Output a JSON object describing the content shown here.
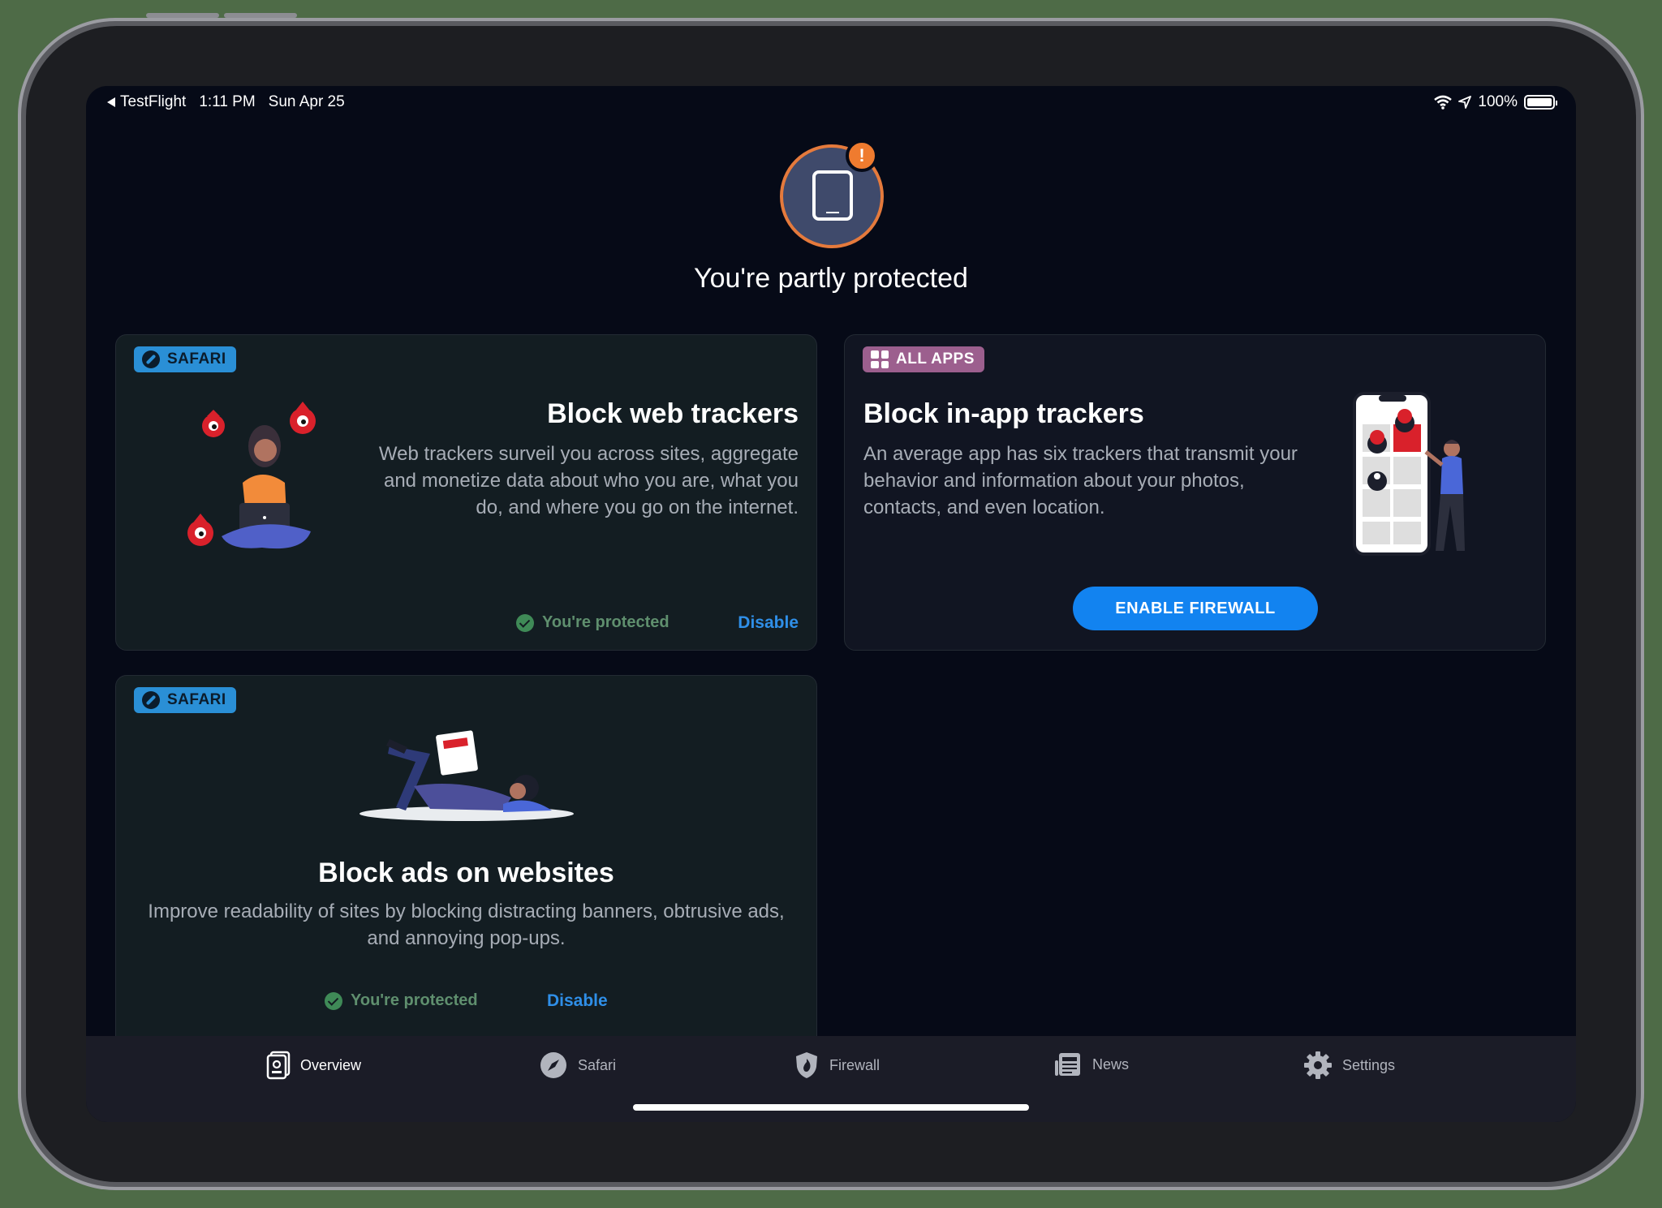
{
  "status_bar": {
    "back_app": "TestFlight",
    "time": "1:11 PM",
    "date": "Sun Apr 25",
    "battery": "100%"
  },
  "hero": {
    "badge": "!",
    "title": "You're partly protected"
  },
  "cards": {
    "web_trackers": {
      "chip": "SAFARI",
      "title": "Block web trackers",
      "description": "Web trackers surveil you across sites, aggregate and monetize data about who you are, what you do, and where you go on the internet.",
      "status": "You're protected",
      "action": "Disable"
    },
    "in_app_trackers": {
      "chip": "ALL APPS",
      "title": "Block in-app trackers",
      "description": "An average app has six trackers that transmit your behavior and information about your photos, contacts, and even location.",
      "action": "ENABLE FIREWALL"
    },
    "ads": {
      "chip": "SAFARI",
      "title": "Block ads on websites",
      "description": "Improve readability of sites by blocking distracting banners, obtrusive ads, and annoying pop-ups.",
      "status": "You're protected",
      "action": "Disable"
    }
  },
  "tabs": [
    {
      "label": "Overview",
      "icon": "overview-icon",
      "active": true
    },
    {
      "label": "Safari",
      "icon": "compass-icon",
      "active": false
    },
    {
      "label": "Firewall",
      "icon": "shield-flame-icon",
      "active": false
    },
    {
      "label": "News",
      "icon": "newspaper-icon",
      "active": false
    },
    {
      "label": "Settings",
      "icon": "gear-icon",
      "active": false
    }
  ],
  "colors": {
    "background": "#060a17",
    "accent_blue": "#1283f0",
    "warning_orange": "#ef7b2f",
    "protected_green": "#3f8a57",
    "safari_chip": "#2a8fd6",
    "apps_chip": "#9c5f8e"
  }
}
